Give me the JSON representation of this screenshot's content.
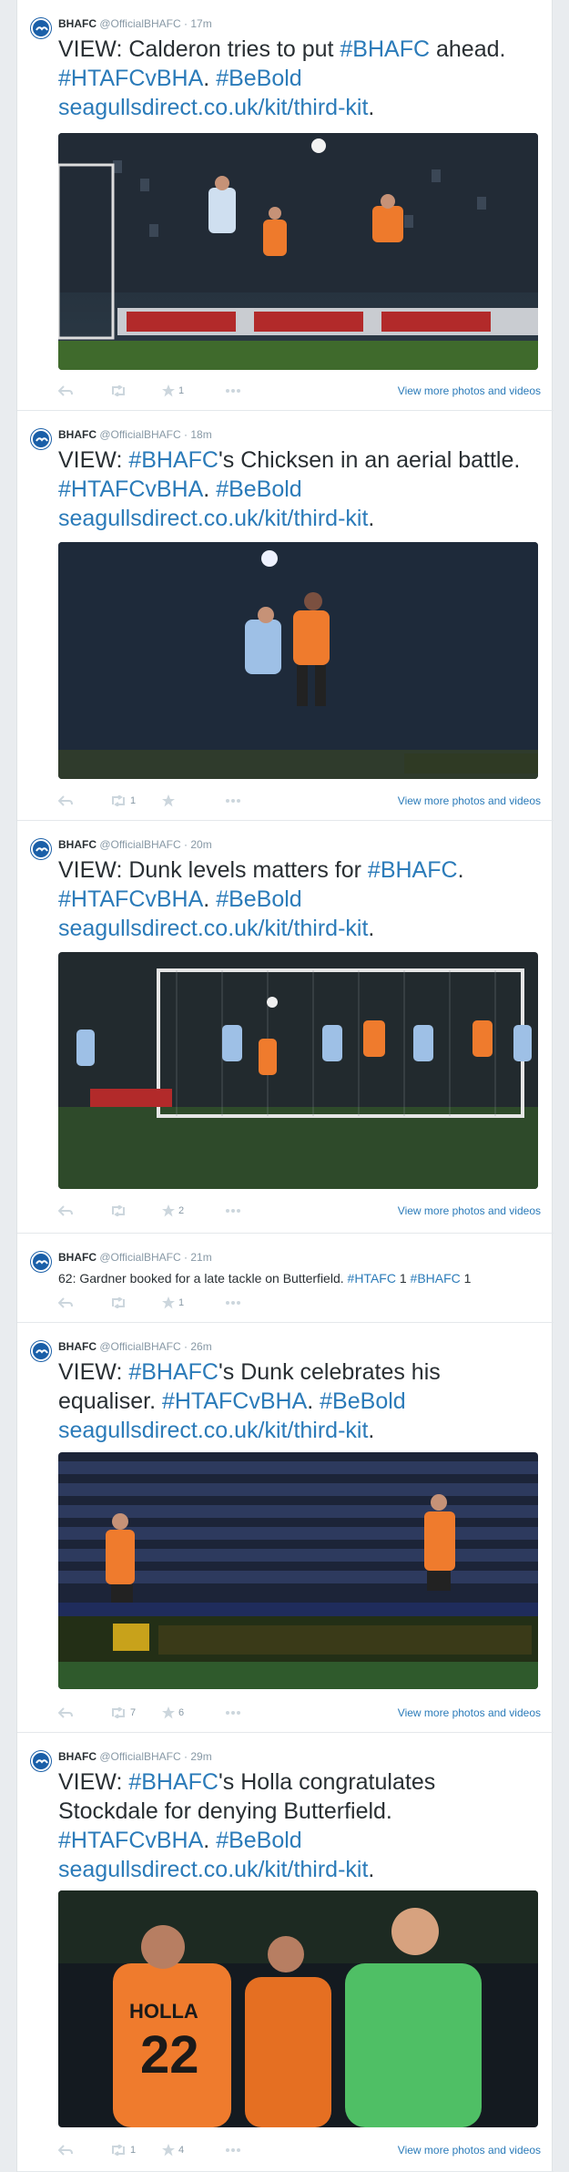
{
  "account": {
    "name": "BHAFC",
    "handle": "@OfficialBHAFC"
  },
  "icons": [
    "reply-icon",
    "retweet-icon",
    "favorite-icon",
    "more-icon",
    "avatar-seagull-icon"
  ],
  "colors": {
    "link": "#2b7bb9",
    "text": "#292f33",
    "muted": "#8899a6"
  },
  "tweets": [
    {
      "time": "17m",
      "parts": [
        "VIEW: Calderon tries to put ",
        "#BHAFC",
        " ahead. ",
        "#HTAFCvBHA",
        ". ",
        "#BeBold",
        " ",
        "seagullsdirect.co.uk/kit/third-kit",
        "."
      ],
      "retweets": "",
      "favorites": "1",
      "more": "View more photos and videos"
    },
    {
      "time": "18m",
      "parts": [
        "VIEW: ",
        "#BHAFC",
        "'s Chicksen in an aerial battle. ",
        "#HTAFCvBHA",
        ". ",
        "#BeBold",
        " ",
        "seagullsdirect.co.uk/kit/third-kit",
        "."
      ],
      "retweets": "1",
      "favorites": "",
      "more": "View more photos and videos"
    },
    {
      "time": "20m",
      "parts": [
        "VIEW: Dunk levels matters for ",
        "#BHAFC",
        ". ",
        "#HTAFCvBHA",
        ". ",
        "#BeBold",
        " ",
        "seagullsdirect.co.uk/kit/third-kit",
        "."
      ],
      "retweets": "",
      "favorites": "2",
      "more": "View more photos and videos"
    },
    {
      "time": "21m",
      "parts": [
        "62: Gardner booked for a late tackle on Butterfield. ",
        "#HTAFC",
        " 1 ",
        "#BHAFC",
        " 1",
        "",
        "",
        "",
        ""
      ],
      "retweets": "",
      "favorites": "1",
      "more": ""
    },
    {
      "time": "26m",
      "parts": [
        "VIEW: ",
        "#BHAFC",
        "'s Dunk celebrates his equaliser. ",
        "#HTAFCvBHA",
        ". ",
        "#BeBold",
        " ",
        "seagullsdirect.co.uk/kit/third-kit",
        "."
      ],
      "retweets": "7",
      "favorites": "6",
      "more": "View more photos and videos"
    },
    {
      "time": "29m",
      "parts": [
        "VIEW: ",
        "#BHAFC",
        "'s Holla congratulates Stockdale for denying Butterfield. ",
        "#HTAFCvBHA",
        ". ",
        "#BeBold",
        " ",
        "seagullsdirect.co.uk/kit/third-kit",
        "."
      ],
      "retweets": "1",
      "favorites": "4",
      "more": "View more photos and videos"
    }
  ]
}
